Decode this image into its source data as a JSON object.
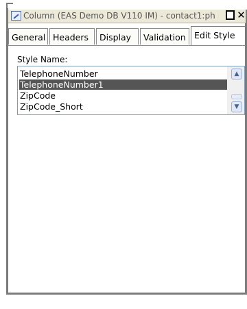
{
  "window": {
    "title": "Column (EAS Demo DB V110 IM) - contact1:ph"
  },
  "tabs": [
    {
      "label": "General"
    },
    {
      "label": "Headers"
    },
    {
      "label": "Display"
    },
    {
      "label": "Validation"
    },
    {
      "label": "Edit Style",
      "active": true
    }
  ],
  "edit_style": {
    "style_name_label": "Style Name:",
    "items": [
      {
        "label": "TelephoneNumber"
      },
      {
        "label": "TelephoneNumber1",
        "selected": true
      },
      {
        "label": "ZipCode"
      },
      {
        "label": "ZipCode_Short"
      }
    ]
  },
  "colors": {
    "selection": "#555555",
    "border": "#7b7b7b",
    "listbox_border": "#7f9db9"
  },
  "icons": {
    "title_icon": "column-icon",
    "restore": "restore-icon",
    "close": "close-icon",
    "scroll_up": "scroll-up-icon",
    "scroll_down": "scroll-down-icon"
  }
}
